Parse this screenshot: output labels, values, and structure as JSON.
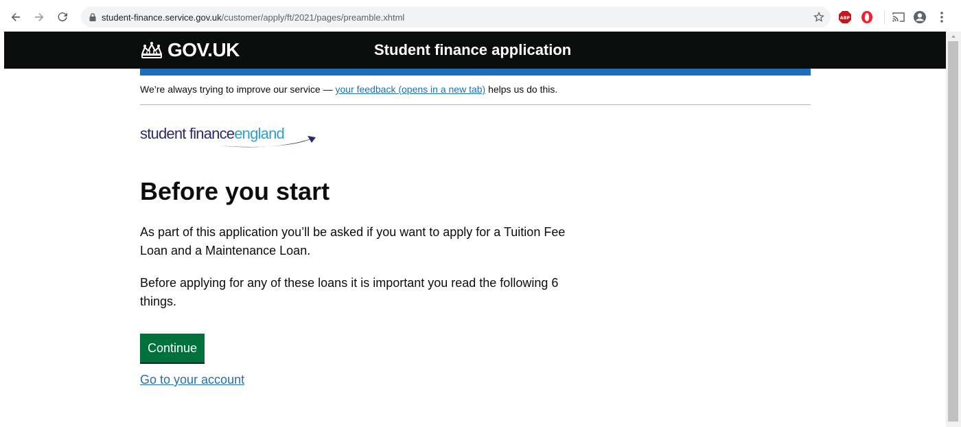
{
  "browser": {
    "url_host": "student-finance.service.gov.uk",
    "url_path": "/customer/apply/ft/2021/pages/preamble.xhtml",
    "icons": [
      "back-icon",
      "forward-icon",
      "reload-icon",
      "lock-icon",
      "star-icon",
      "adblock-icon",
      "opera-icon",
      "cast-icon",
      "account-icon",
      "menu-icon"
    ],
    "extension_label": "ABP"
  },
  "header": {
    "logotype": "GOV.UK",
    "service_name": "Student finance application",
    "brand_color": "#1d70b8"
  },
  "feedback": {
    "before": "We’re always trying to improve our service — ",
    "link": "your feedback (opens in a new tab)",
    "after": " helps us do this."
  },
  "logo": {
    "part1": "student finance",
    "part2": "england"
  },
  "main": {
    "heading": "Before you start",
    "paragraph1": "As part of this application you’ll be asked if you want to apply for a Tuition Fee Loan and a Maintenance Loan.",
    "paragraph2": "Before applying for any of these loans it is important you read the following 6 things.",
    "continue_label": "Continue",
    "account_link": "Go to your account",
    "button_color": "#00703c"
  }
}
